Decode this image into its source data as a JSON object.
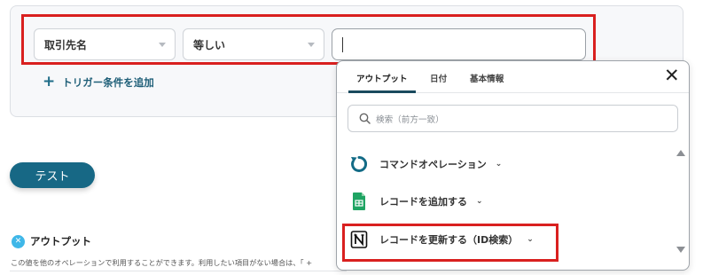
{
  "trigger_condition": {
    "field_select": {
      "value": "取引先名"
    },
    "operator_select": {
      "value": "等しい"
    },
    "value_input": {
      "value": ""
    },
    "add_trigger_label": "トリガー条件を追加"
  },
  "test_button_label": "テスト",
  "output_section": {
    "title": "アウトプット",
    "description": "この値を他のオペレーションで利用することができます。利用したい項目がない場合は、「 +"
  },
  "popup": {
    "tabs": [
      {
        "label": "アウトプット",
        "active": true
      },
      {
        "label": "日付",
        "active": false
      },
      {
        "label": "基本情報",
        "active": false
      }
    ],
    "close_symbol": "✕",
    "search_placeholder": "検索（前方一致）",
    "operations": [
      {
        "label": "コマンドオペレーション",
        "icon": "command-operation-icon"
      },
      {
        "label": "レコードを追加する",
        "icon": "google-sheets-icon"
      },
      {
        "label": "レコードを更新する（ID検索）",
        "icon": "notion-icon"
      }
    ]
  },
  "colors": {
    "highlight": "#d9201f",
    "primary": "#176885",
    "sheets_green": "#1fa463",
    "command_teal": "#136b86"
  }
}
